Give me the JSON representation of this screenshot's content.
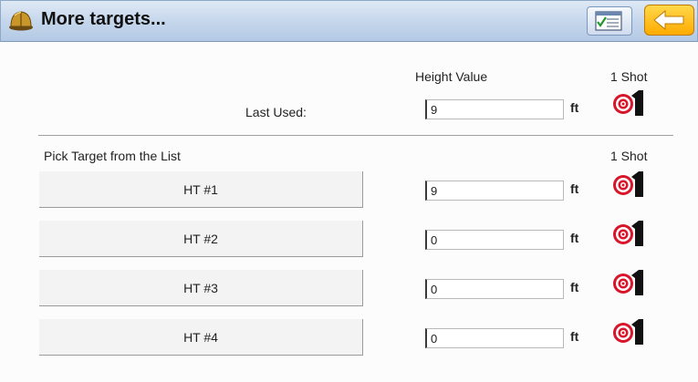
{
  "window": {
    "title": "More targets..."
  },
  "toolbar": {
    "list_icon": "checklist-icon",
    "back_icon": "back-arrow-icon"
  },
  "header": {
    "height_value": "Height Value",
    "one_shot": "1 Shot"
  },
  "last_used": {
    "label": "Last Used:",
    "value": "9",
    "unit": "ft"
  },
  "pick": {
    "title": "Pick Target from the List",
    "one_shot": "1 Shot"
  },
  "targets": [
    {
      "label": "HT #1",
      "value": "9",
      "unit": "ft"
    },
    {
      "label": "HT #2",
      "value": "0",
      "unit": "ft"
    },
    {
      "label": "HT #3",
      "value": "0",
      "unit": "ft"
    },
    {
      "label": "HT #4",
      "value": "0",
      "unit": "ft"
    }
  ],
  "colors": {
    "titlebar": "#c6d7ec",
    "back_button": "#ffab00",
    "target_red": "#d8152a"
  }
}
